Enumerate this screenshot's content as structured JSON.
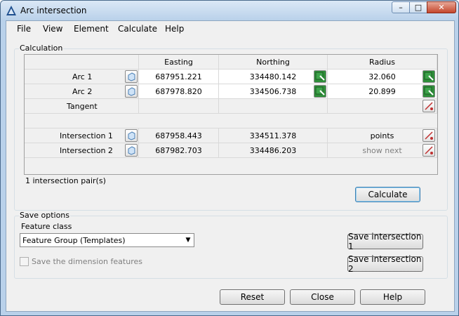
{
  "window": {
    "title": "Arc intersection"
  },
  "menu": [
    "File",
    "View",
    "Element",
    "Calculate",
    "Help"
  ],
  "calculation": {
    "group_label": "Calculation",
    "columns": [
      "Easting",
      "Northing",
      "Radius"
    ],
    "rows": {
      "arc1": {
        "label": "Arc 1",
        "easting": "687951.221",
        "northing": "334480.142",
        "radius": "32.060"
      },
      "arc2": {
        "label": "Arc 2",
        "easting": "687978.820",
        "northing": "334506.738",
        "radius": "20.899"
      },
      "tangent": {
        "label": "Tangent"
      },
      "int1": {
        "label": "Intersection 1",
        "easting": "687958.443",
        "northing": "334511.378",
        "radius": "points"
      },
      "int2": {
        "label": "Intersection 2",
        "easting": "687982.703",
        "northing": "334486.203",
        "radius": "show next"
      }
    },
    "status": "1 intersection pair(s)",
    "calculate_button": "Calculate"
  },
  "save_options": {
    "group_label": "Save options",
    "feature_class_label": "Feature class",
    "feature_class_value": "Feature Group (Templates)",
    "save_dimension_label": "Save the dimension features",
    "save_int1_button": "Save intersection 1",
    "save_int2_button": "Save intersection 2"
  },
  "footer": {
    "reset": "Reset",
    "close": "Close",
    "help": "Help"
  },
  "colors": {
    "title_bar": "#b9d1ea",
    "close_button": "#c4462b",
    "focus_border": "#3c7fb1"
  }
}
